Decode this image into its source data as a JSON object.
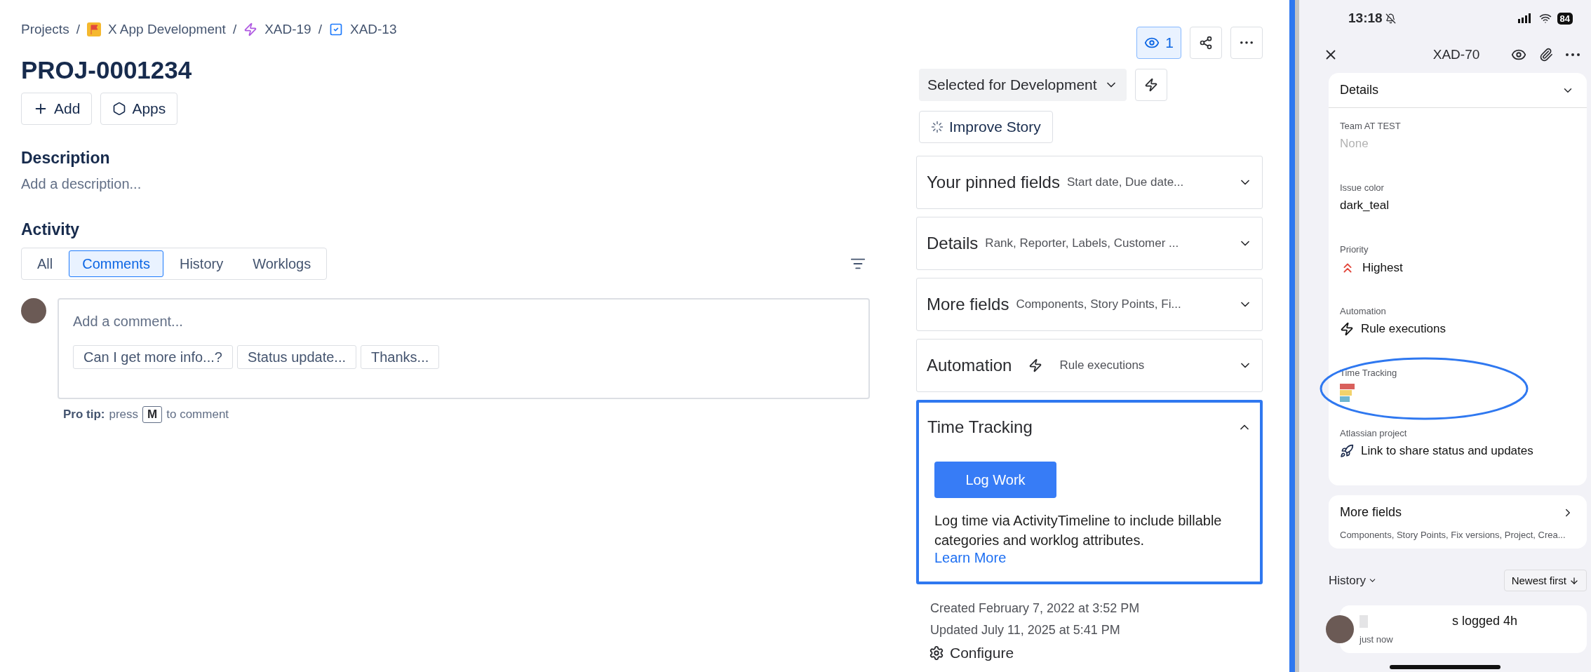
{
  "breadcrumbs": [
    {
      "label": "Projects",
      "kind": "text",
      "separator": "/"
    },
    {
      "label": "X App Development",
      "kind": "project",
      "separator": "/"
    },
    {
      "label": "XAD-19",
      "kind": "epic",
      "separator": "/"
    },
    {
      "label": "XAD-13",
      "kind": "task"
    }
  ],
  "issue": {
    "title": "PROJ-0001234"
  },
  "actions": [
    {
      "label": "Add",
      "kind": "add"
    },
    {
      "label": "Apps",
      "kind": "apps"
    }
  ],
  "description": {
    "heading": "Description",
    "placeholder": "Add a description..."
  },
  "activity": {
    "heading": "Activity",
    "tabs": [
      {
        "label": "All",
        "selected": false
      },
      {
        "label": "Comments",
        "selected": true
      },
      {
        "label": "History",
        "selected": false
      },
      {
        "label": "Worklogs",
        "selected": false
      }
    ],
    "comment": {
      "placeholder": "Add a comment...",
      "suggestions": [
        "Can I get more info...?",
        "Status update...",
        "Thanks..."
      ]
    },
    "pro_tip": {
      "lead": "Pro tip:",
      "before": "press",
      "key": "M",
      "after": "to comment"
    }
  },
  "toolbar": {
    "watchers": "1"
  },
  "status": {
    "label": "Selected for Development"
  },
  "improve": {
    "label": "Improve Story"
  },
  "panels": [
    {
      "title": "Your pinned fields",
      "summary": "Start date, Due date...",
      "kind": "summary",
      "expanded": false,
      "highlighted": false
    },
    {
      "title": "Details",
      "summary": "Rank, Reporter, Labels, Customer ...",
      "kind": "summary",
      "expanded": false,
      "highlighted": false
    },
    {
      "title": "More fields",
      "summary": "Components, Story Points, Fi...",
      "kind": "summary",
      "expanded": false,
      "highlighted": false
    },
    {
      "title": "Automation",
      "summary": "Rule executions",
      "kind": "automation",
      "expanded": false,
      "highlighted": false
    },
    {
      "title": "Time Tracking",
      "kind": "tracking",
      "expanded": true,
      "highlighted": true,
      "button": "Log Work",
      "text": "Log time via ActivityTimeline to include billable categories and worklog attributes.",
      "link": "Learn More"
    }
  ],
  "meta": {
    "created": "Created February 7, 2022 at 3:52 PM",
    "updated": "Updated July 11, 2025 at 5:41 PM",
    "configure": "Configure"
  },
  "phone": {
    "time": "13:18",
    "battery": "84",
    "title": "XAD-70",
    "details": {
      "title": "Details",
      "fields": [
        {
          "label": "Team AT TEST",
          "value": "None",
          "kind": "muted"
        },
        {
          "label": "Issue color",
          "value": "dark_teal",
          "kind": "plain"
        },
        {
          "label": "Priority",
          "value": "Highest",
          "kind": "priority"
        },
        {
          "label": "Automation",
          "value": "Rule executions",
          "kind": "automation"
        },
        {
          "label": "Time Tracking",
          "kind": "tracking",
          "highlighted": true
        },
        {
          "label": "Atlassian project",
          "value": "Link to share status and updates",
          "kind": "link"
        }
      ]
    },
    "more_fields": {
      "title": "More fields",
      "summary": "Components, Story Points, Fix versions, Project, Crea..."
    },
    "history": {
      "title": "History",
      "sort": "Newest first",
      "entry": {
        "text": "s logged 4h",
        "time": "just now"
      }
    }
  }
}
